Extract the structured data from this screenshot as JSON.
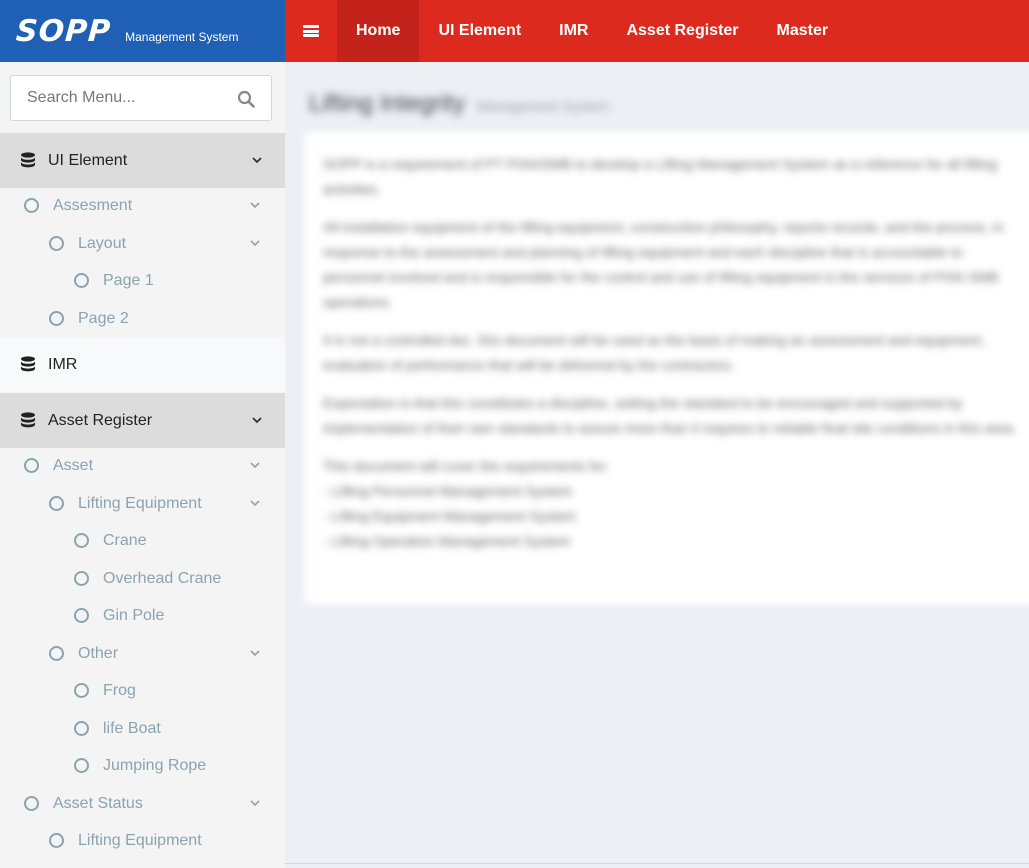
{
  "brand": {
    "logo": "SOPP",
    "subtitle": "Management System"
  },
  "topnav": {
    "items": [
      {
        "label": "Home",
        "active": true
      },
      {
        "label": "UI Element",
        "active": false
      },
      {
        "label": "IMR",
        "active": false
      },
      {
        "label": "Asset Register",
        "active": false
      },
      {
        "label": "Master",
        "active": false
      }
    ]
  },
  "sidebar": {
    "search_placeholder": "Search Menu...",
    "menus": [
      {
        "label": "UI Element",
        "icon": "database-icon",
        "expanded": true
      },
      {
        "label": "IMR",
        "icon": "database-icon",
        "expanded": false
      },
      {
        "label": "Asset Register",
        "icon": "database-icon",
        "expanded": true
      }
    ],
    "ui_element": {
      "assesment": "Assesment",
      "layout": "Layout",
      "page1": "Page 1",
      "page2": "Page 2"
    },
    "asset_register": {
      "asset": "Asset",
      "lifting_equipment": "Lifting Equipment",
      "crane": "Crane",
      "overhead_crane": "Overhead Crane",
      "gin_pole": "Gin Pole",
      "other": "Other",
      "frog": "Frog",
      "life_boat": "life Boat",
      "jumping_rope": "Jumping Rope",
      "asset_status": "Asset Status",
      "status_lifting_equipment": "Lifting Equipment"
    }
  },
  "content": {
    "title": "Lifting Integrity",
    "subtitle": "Management System",
    "paragraphs": [
      "SOPP is a requirement of PT PGN/SMB to develop a Lifting Management System as a reference for all lifting activities.",
      "All installation equipment of the lifting equipment, construction philosophy, reports records, and the process, in response to the assessment and planning of lifting equipment and each discipline that is accountable to personnel involved and is responsible for the control and use of lifting equipment in the services of PGN SMB operations.",
      "It is not a controlled doc. this document will be used as the basis of making an assessment and equipment, evaluation of performance that will be delivered by the contractors.",
      "Expectation is that this constitutes a discipline, setting the standard to be encouraged and supported by implementation of their own standards to assure more than it requires to reliable final site conditions in this area."
    ],
    "list_intro": "This document will cover the requirements for:",
    "list": [
      "- Lifting Personnel Management System",
      "- Lifting Equipment Management System",
      "- Lifting Operation Management System"
    ]
  },
  "colors": {
    "brand_bg": "#1f5fb4",
    "topnav_bg": "#dd2a1f",
    "topnav_active": "#c4231b",
    "sidebar_bg": "#f4f4f4",
    "submenu_text": "#8aa4af"
  }
}
